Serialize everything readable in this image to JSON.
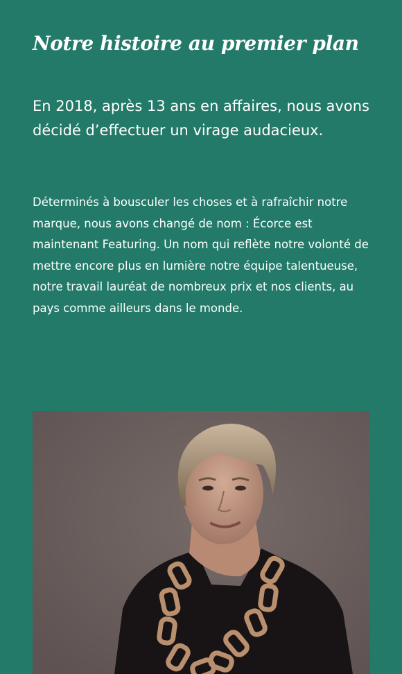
{
  "section": {
    "title": "Notre histoire au premier plan",
    "lead": "En 2018, après 13 ans en affaires, nous avons décidé d’effectuer un virage audacieux.",
    "body": "Déterminés à bousculer les choses et à rafraîchir notre marque, nous avons changé de nom : Écorce est maintenant Featuring. Un nom qui reflète notre volonté de mettre encore plus en lumière notre équipe talentueuse, notre travail lauréat de nombreux prix et nos clients, au pays comme ailleurs dans le monde."
  },
  "colors": {
    "background": "#237a68",
    "text": "#ffffff",
    "photo_background": "#6c6160"
  },
  "photo": {
    "subject": "portrait-photo"
  }
}
